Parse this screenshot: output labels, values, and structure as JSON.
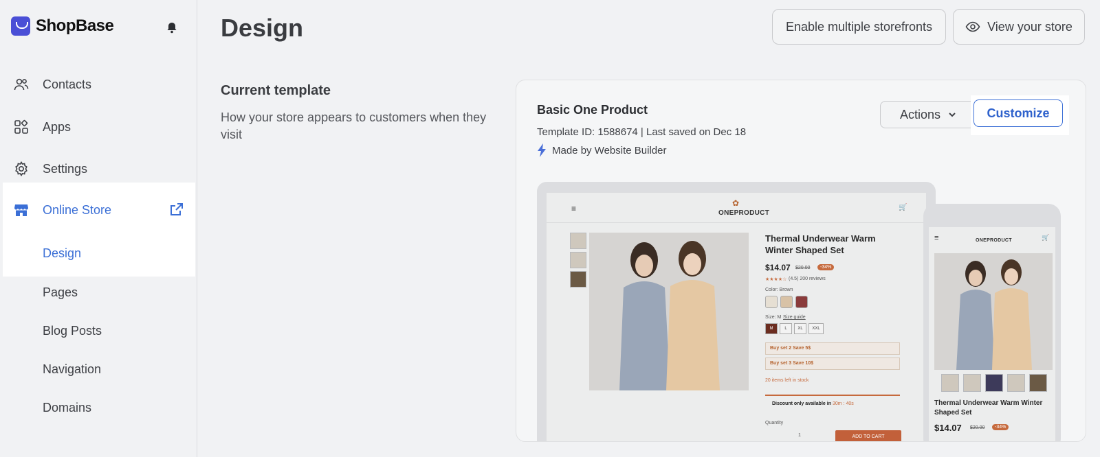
{
  "app": {
    "name": "ShopBase"
  },
  "sidebar": {
    "items": [
      {
        "label": "Contacts",
        "icon": "contacts-icon"
      },
      {
        "label": "Apps",
        "icon": "apps-icon"
      },
      {
        "label": "Settings",
        "icon": "gear-icon"
      },
      {
        "label": "Online Store",
        "icon": "store-icon"
      }
    ],
    "subitems": [
      "Design",
      "Pages",
      "Blog Posts",
      "Navigation",
      "Domains"
    ]
  },
  "header": {
    "title": "Design",
    "enable_multiple_label": "Enable multiple storefronts",
    "view_store_label": "View your store"
  },
  "section": {
    "title": "Current template",
    "description": "How your store appears to customers when they visit"
  },
  "template": {
    "name": "Basic One Product",
    "meta": "Template ID: 1588674 | Last saved on Dec 18",
    "made_by": "Made by Website Builder",
    "actions_label": "Actions",
    "customize_label": "Customize"
  },
  "preview": {
    "logo": "ONEPRODUCT",
    "product_title": "Thermal Underwear Warm Winter Shaped Set",
    "price": "$14.07",
    "old_price": "$20.00",
    "discount": "-34%",
    "rating": "(4.5) 200 reviews",
    "color_label": "Color: Brown",
    "size_label": "Size: M",
    "size_guide": "Size guide",
    "sizes": [
      "M",
      "L",
      "XL",
      "XXL"
    ],
    "offers": [
      "Buy set 2 Save 5$",
      "Buy set 3 Save 10$"
    ],
    "stock": "20 items left in stock",
    "discount_note": "Discount only available in",
    "timer": "30m : 40s",
    "quantity_label": "Quantity",
    "quantity": "1",
    "add_to_cart": "ADD TO CART"
  },
  "colors": {
    "accent": "#3b6fd6",
    "brand": "#4a4fd6",
    "cart": "#c2603a"
  }
}
